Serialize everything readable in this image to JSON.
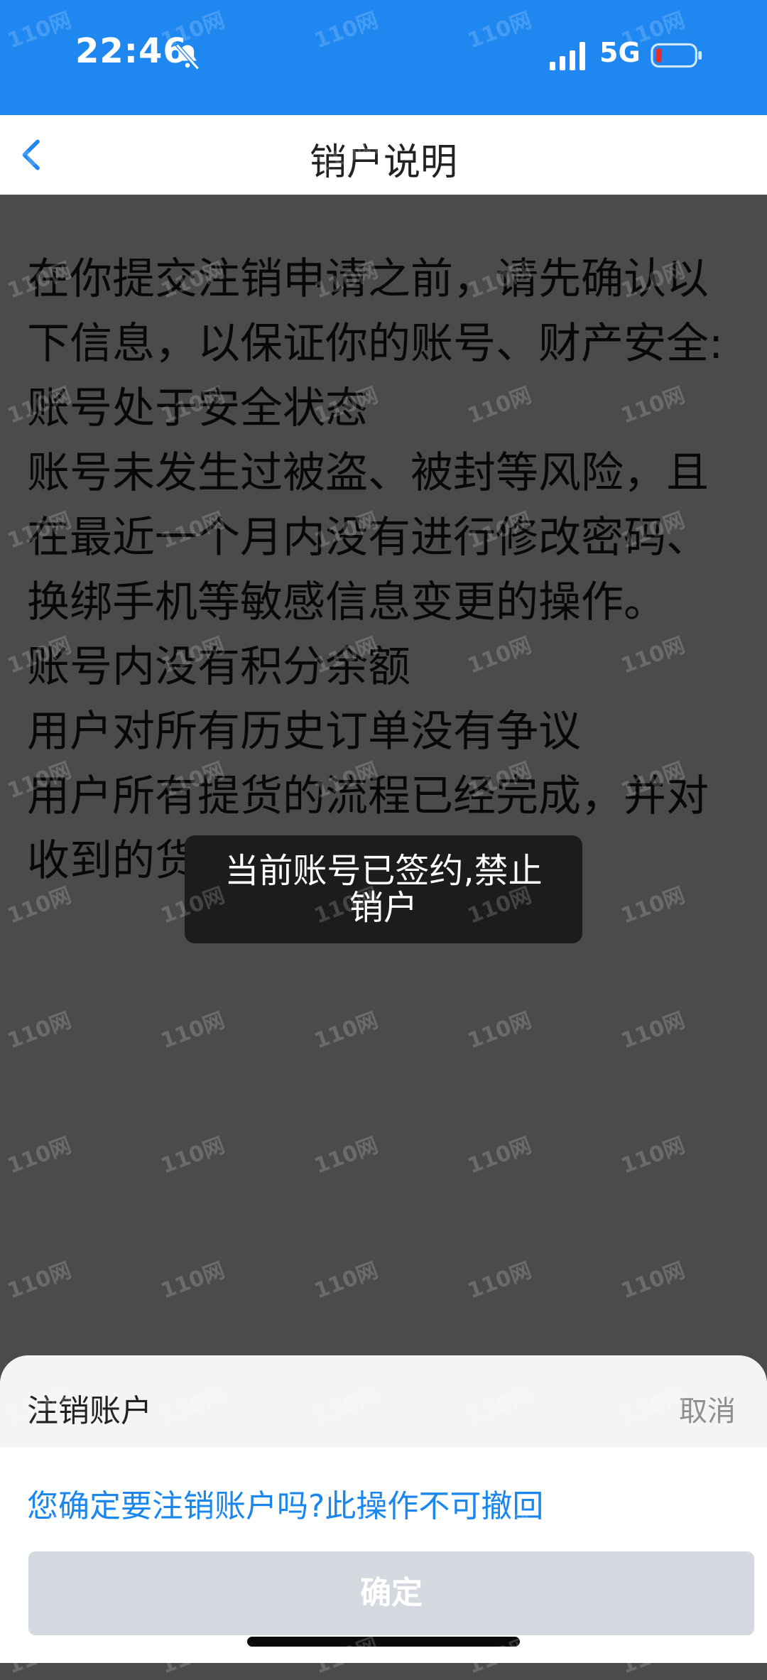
{
  "status_bar": {
    "time": "22:46",
    "network": "5G",
    "icons": [
      "bell-slash-icon",
      "signal-icon",
      "battery-icon"
    ],
    "color": "#1e87f0",
    "battery_color": "#e03030"
  },
  "nav": {
    "title": "销户说明",
    "back_icon": "chevron-left-icon",
    "accent": "#1e87f0"
  },
  "content": {
    "lines": [
      "在你提交注销申请之前，请先确认以下信息，以保证你的账号、财产安全:",
      "账号处于安全状态",
      "账号未发生过被盗、被封等风险，且在最近一个月内没有进行修改密码、换绑手机等敏感信息变更的操作。",
      "账号内没有积分余额",
      "用户对所有历史订单没有争议",
      "用户所有提货的流程已经完成，并对收到的货物没有争议"
    ]
  },
  "toast": {
    "message": "当前账号已签约,禁止销户"
  },
  "sheet": {
    "title": "注销账户",
    "cancel": "取消",
    "message": "您确定要注销账户吗?此操作不可撤回",
    "confirm": "确定",
    "message_color": "#1a86ee",
    "confirm_bg": "#d3d9df"
  },
  "watermark": "110网"
}
